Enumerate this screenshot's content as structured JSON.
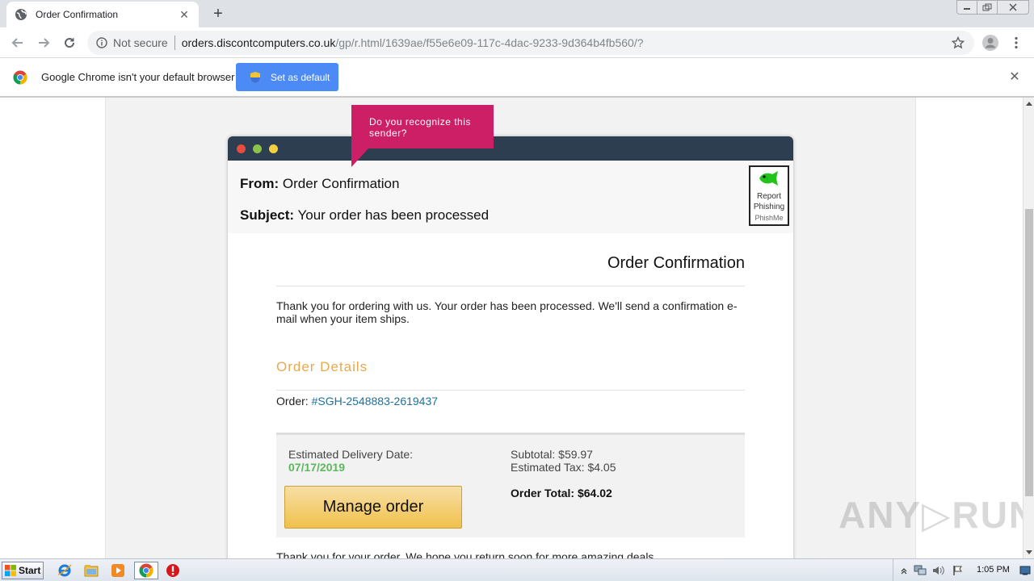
{
  "tab": {
    "title": "Order Confirmation",
    "close_glyph": "✕",
    "new_tab_glyph": "+"
  },
  "window_controls": {
    "minimize": "–",
    "maximize": "❐",
    "close": "✕"
  },
  "toolbar": {
    "security_label": "Not secure",
    "url_host": "orders.discontcomputers.co.uk",
    "url_path": "/gp/r.html/1639ae/f55e6e09-117c-4dac-9233-9d364b4fb560/?"
  },
  "infobar": {
    "message": "Google Chrome isn't your default browser",
    "button_label": "Set as default",
    "close_glyph": "✕"
  },
  "phishme": {
    "tooltip": "Do you recognize this sender?",
    "report_line1": "Report",
    "report_line2": "Phishing",
    "brand": "PhishMe"
  },
  "email": {
    "from_label": "From:",
    "from_value": "Order Confirmation",
    "subject_label": "Subject:",
    "subject_value": "Your order has been processed",
    "heading": "Order Confirmation",
    "thanks": "Thank you for ordering with us. Your order has been processed. We'll send a confirmation e-mail when your item ships.",
    "details_heading": "Order Details",
    "order_label": "Order:",
    "order_number": "#SGH-2548883-2619437",
    "delivery_label": "Estimated Delivery Date:",
    "delivery_date": "07/17/2019",
    "subtotal": "Subtotal: $59.97",
    "tax": "Estimated Tax: $4.05",
    "total": "Order Total: $64.02",
    "manage_button": "Manage order",
    "closing": "Thank you for your order. We hope you return soon for more amazing deals."
  },
  "watermark": "ANY▷RUN",
  "taskbar": {
    "start_label": "Start",
    "clock": "1:05 PM"
  },
  "colors": {
    "titlebar": "#2c3e50",
    "dot_red": "#e74c3c",
    "dot_green": "#8bc34a",
    "dot_yellow": "#f4d03f",
    "tooltip": "#cc1f65",
    "order_details": "#e8a94c",
    "delivery_green": "#5cb85c",
    "order_link": "#1f6f9f",
    "button_blue": "#4c8bf5"
  }
}
